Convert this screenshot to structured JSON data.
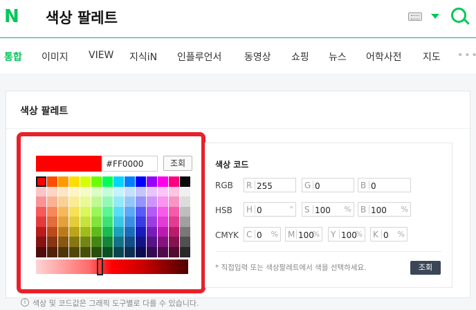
{
  "header": {
    "logo": "N",
    "query": "색상 팔레트",
    "icons": [
      "keyboard-icon",
      "dropdown-icon",
      "search-icon"
    ],
    "brand_color": "#03c75a"
  },
  "tabs": [
    {
      "label": "통합",
      "active": true
    },
    {
      "label": "이미지"
    },
    {
      "label": "VIEW"
    },
    {
      "label": "지식iN"
    },
    {
      "label": "인플루언서"
    },
    {
      "label": "동영상"
    },
    {
      "label": "쇼핑"
    },
    {
      "label": "뉴스"
    },
    {
      "label": "어학사전"
    },
    {
      "label": "지도"
    }
  ],
  "tab_more": "•••",
  "card": {
    "title": "색상 팔레트",
    "picker": {
      "current_hex": "#FF0000",
      "lookup_button": "조회",
      "highlight_color": "#e8202b"
    },
    "codes": {
      "title": "색상 코드",
      "rgb": {
        "label": "RGB",
        "r_key": "R",
        "r": "255",
        "g_key": "G",
        "g": "0",
        "b_key": "B",
        "b": "0"
      },
      "hsb": {
        "label": "HSB",
        "h_key": "H",
        "h": "0",
        "h_unit": "°",
        "s_key": "S",
        "s": "100",
        "s_unit": "%",
        "b_key": "B",
        "b": "100",
        "b_unit": "%"
      },
      "cmyk": {
        "label": "CMYK",
        "c_key": "C",
        "c": "0",
        "m_key": "M",
        "m": "100",
        "y_key": "Y",
        "y": "100",
        "k_key": "K",
        "k": "0",
        "unit": "%"
      },
      "hint": "* 직접입력 또는 색상팔레트에서 색을 선택하세요.",
      "apply_button": "조회"
    }
  },
  "footer_note": "색상 및 코드값은 그래픽 도구별로 다를 수 있습니다."
}
